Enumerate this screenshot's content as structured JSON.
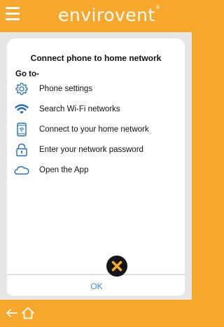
{
  "header": {
    "logo_text": "envirovent",
    "logo_mark": "®",
    "menu_icon": "hamburger-menu-icon"
  },
  "dialog": {
    "title": "Connect phone to home network",
    "intro": "Go to-",
    "steps": [
      {
        "icon": "gear-icon",
        "label": "Phone settings"
      },
      {
        "icon": "wifi-icon",
        "label": "Search Wi-Fi networks"
      },
      {
        "icon": "phone-wifi-icon",
        "label": "Connect to your home network"
      },
      {
        "icon": "lock-icon",
        "label": "Enter your network password"
      },
      {
        "icon": "cloud-icon",
        "label": "Open the App"
      }
    ],
    "ok_label": "OK",
    "close_icon": "close-icon"
  },
  "nav": {
    "back_icon": "back-arrow-icon",
    "home_icon": "home-icon"
  },
  "colors": {
    "brand_orange": "#f5a82c",
    "icon_blue": "#1f6fb8",
    "ok_blue": "#3a8fd8",
    "close_dark": "#151515",
    "close_x": "#f5a82c",
    "background_grey": "#e6e6e6"
  }
}
